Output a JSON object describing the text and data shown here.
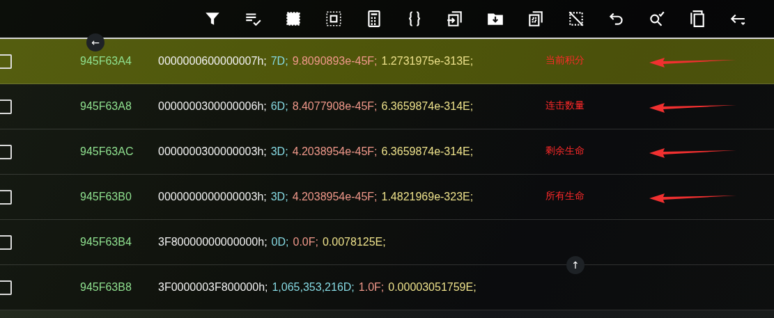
{
  "toolbar": {
    "buttons": [
      {
        "kind": "filter"
      },
      {
        "kind": "select-list"
      },
      {
        "kind": "select-all"
      },
      {
        "kind": "select-inner"
      },
      {
        "kind": "calculator"
      },
      {
        "kind": "braces"
      },
      {
        "kind": "move"
      },
      {
        "kind": "save"
      },
      {
        "kind": "copy-dotted"
      },
      {
        "kind": "clear-selection"
      },
      {
        "kind": "undo"
      },
      {
        "kind": "search-check"
      },
      {
        "kind": "copy"
      },
      {
        "kind": "back"
      }
    ]
  },
  "floating_buttons": [
    {
      "kind": "left",
      "label": "←"
    },
    {
      "kind": "up",
      "label": "↑"
    }
  ],
  "rows": [
    {
      "address": "945F63A4",
      "hex": "0000000600000007h;",
      "dword": "7D;",
      "float": "9.8090893e-45F;",
      "double": "1.2731975e-313E;",
      "checked": false,
      "selected": true,
      "annotation": "当前积分"
    },
    {
      "address": "945F63A8",
      "hex": "0000000300000006h;",
      "dword": "6D;",
      "float": "8.4077908e-45F;",
      "double": "6.3659874e-314E;",
      "checked": false,
      "selected": false,
      "annotation": "连击数量"
    },
    {
      "address": "945F63AC",
      "hex": "0000000300000003h;",
      "dword": "3D;",
      "float": "4.2038954e-45F;",
      "double": "6.3659874e-314E;",
      "checked": false,
      "selected": false,
      "annotation": "剩余生命"
    },
    {
      "address": "945F63B0",
      "hex": "0000000000000003h;",
      "dword": "3D;",
      "float": "4.2038954e-45F;",
      "double": "1.4821969e-323E;",
      "checked": false,
      "selected": false,
      "annotation": "所有生命"
    },
    {
      "address": "945F63B4",
      "hex": "3F80000000000000h;",
      "dword": "0D;",
      "float": "0.0F;",
      "double": "0.0078125E;",
      "checked": false,
      "selected": false
    },
    {
      "address": "945F63B8",
      "hex": "3F0000003F800000h;",
      "dword": "1,065,353,216D;",
      "float": "1.0F;",
      "double": "0.00003051759E;",
      "checked": false,
      "selected": false
    }
  ]
}
